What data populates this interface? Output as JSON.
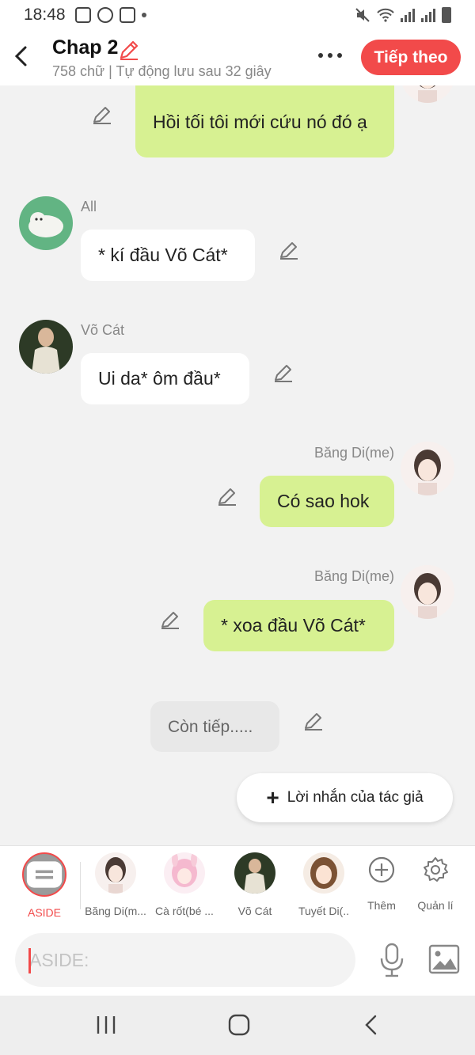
{
  "status_bar": {
    "time": "18:48"
  },
  "header": {
    "title": "Chap 2",
    "subtitle": "758 chữ | Tự động lưu sau 32 giây",
    "next_label": "Tiếp theo"
  },
  "messages": [
    {
      "side": "me",
      "sender": "",
      "text": "Hồi tối tôi mới cứu nó đó ạ"
    },
    {
      "side": "other",
      "sender": "All",
      "text": "* kí đầu Võ Cát*"
    },
    {
      "side": "other",
      "sender": "Võ Cát",
      "text": "Ui da* ôm đầu*"
    },
    {
      "side": "me",
      "sender": "Băng Di(me)",
      "text": "Có sao hok"
    },
    {
      "side": "me",
      "sender": "Băng Di(me)",
      "text": "* xoa đầu Võ Cát*"
    },
    {
      "side": "aside",
      "sender": "",
      "text": "Còn tiếp....."
    }
  ],
  "author_note_label": "Lời nhắn của tác giả",
  "characters": [
    {
      "name": "ASIDE",
      "selected": true
    },
    {
      "name": "Băng Di(m...",
      "selected": false
    },
    {
      "name": "Cà rốt(bé ...",
      "selected": false
    },
    {
      "name": "Võ Cát",
      "selected": false
    },
    {
      "name": "Tuyết Di(..",
      "selected": false
    }
  ],
  "tools": {
    "add_label": "Thêm",
    "manage_label": "Quản lí"
  },
  "input": {
    "placeholder": "ASIDE:",
    "value": ""
  },
  "colors": {
    "accent": "#f24a4a",
    "my_bubble": "#d7f192",
    "other_bubble": "#ffffff",
    "background": "#f2f2f2"
  }
}
